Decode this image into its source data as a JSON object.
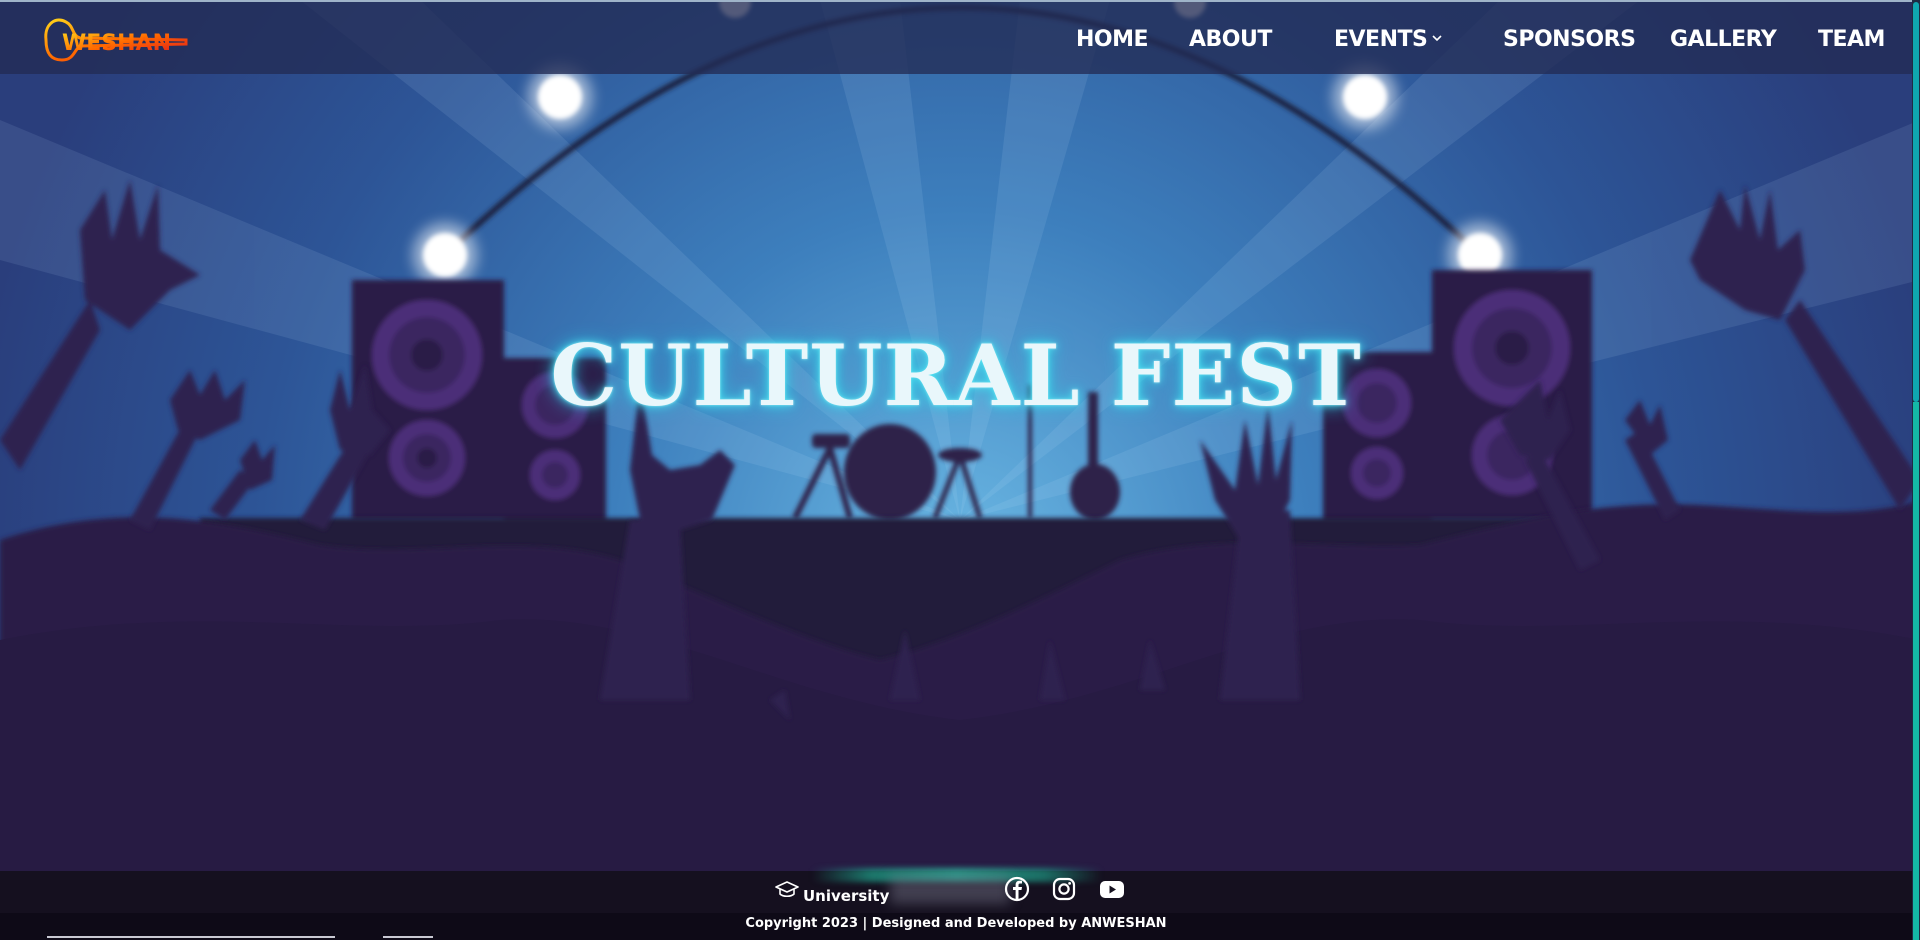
{
  "brand": {
    "logo_alt": "Anweshan logo",
    "logo_text": "WESHAN"
  },
  "nav": {
    "items": [
      {
        "label": "HOME"
      },
      {
        "label": "ABOUT"
      },
      {
        "label": "EVENTS"
      },
      {
        "label": "SPONSORS"
      },
      {
        "label": "GALLERY"
      },
      {
        "label": "TEAM"
      }
    ]
  },
  "hero": {
    "title": "CULTURAL FEST"
  },
  "footer": {
    "university_label": "University",
    "social": [
      {
        "icon": "facebook-icon"
      },
      {
        "icon": "instagram-icon"
      },
      {
        "icon": "youtube-icon"
      }
    ],
    "copyright": "Copyright 2023 | Designed and Developed by ANWESHAN"
  },
  "colors": {
    "nav_bg": "#222c54",
    "crowd": "#261a3f",
    "glow": "#4fe3f2",
    "accent": "#14b8a6"
  }
}
